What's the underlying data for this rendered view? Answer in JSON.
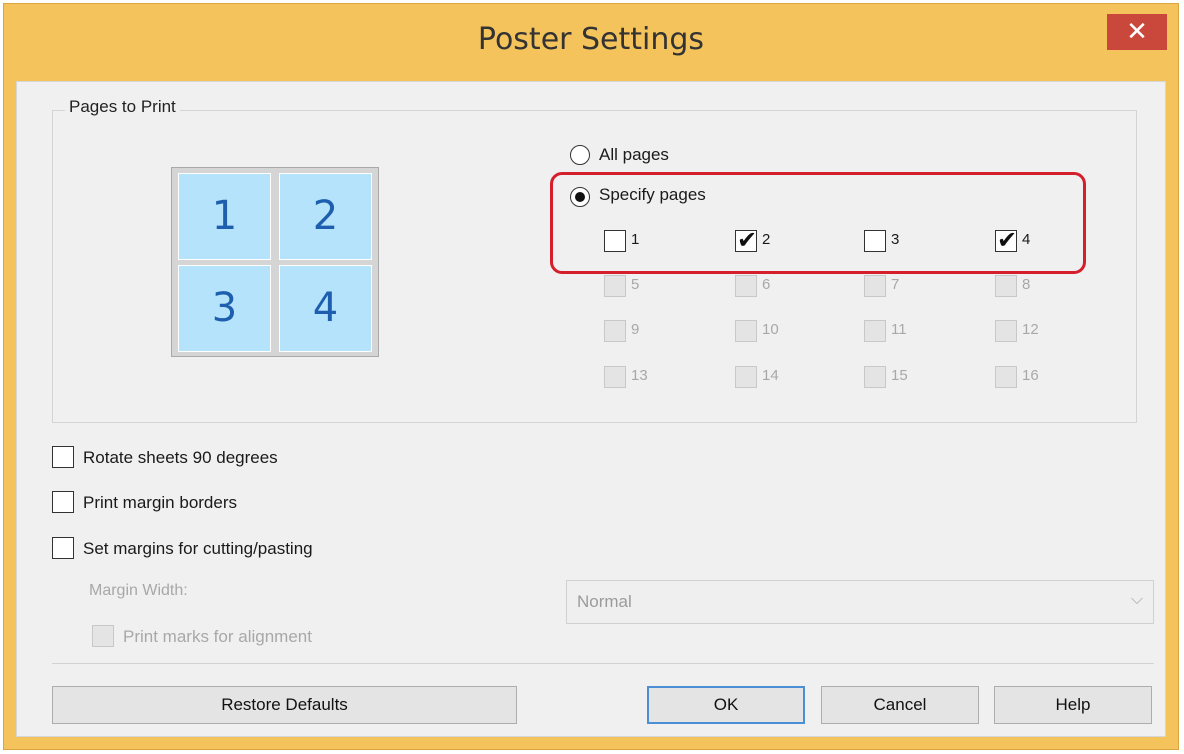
{
  "window": {
    "title": "Poster Settings",
    "close_glyph": "✕"
  },
  "pages_group": {
    "label": "Pages to Print",
    "preview_tiles": [
      "1",
      "2",
      "3",
      "4"
    ],
    "all_pages_label": "All pages",
    "specify_pages_label": "Specify pages",
    "selected_mode": "Specify pages",
    "pages": [
      {
        "label": "1",
        "checked": false,
        "enabled": true
      },
      {
        "label": "2",
        "checked": true,
        "enabled": true
      },
      {
        "label": "3",
        "checked": false,
        "enabled": true
      },
      {
        "label": "4",
        "checked": true,
        "enabled": true
      },
      {
        "label": "5",
        "checked": false,
        "enabled": false
      },
      {
        "label": "6",
        "checked": false,
        "enabled": false
      },
      {
        "label": "7",
        "checked": false,
        "enabled": false
      },
      {
        "label": "8",
        "checked": false,
        "enabled": false
      },
      {
        "label": "9",
        "checked": false,
        "enabled": false
      },
      {
        "label": "10",
        "checked": false,
        "enabled": false
      },
      {
        "label": "11",
        "checked": false,
        "enabled": false
      },
      {
        "label": "12",
        "checked": false,
        "enabled": false
      },
      {
        "label": "13",
        "checked": false,
        "enabled": false
      },
      {
        "label": "14",
        "checked": false,
        "enabled": false
      },
      {
        "label": "15",
        "checked": false,
        "enabled": false
      },
      {
        "label": "16",
        "checked": false,
        "enabled": false
      }
    ]
  },
  "options": {
    "rotate_label": "Rotate sheets 90 degrees",
    "rotate_checked": false,
    "margin_borders_label": "Print margin borders",
    "margin_borders_checked": false,
    "cutting_label": "Set margins for cutting/pasting",
    "cutting_checked": false,
    "margin_width_label": "Margin Width:",
    "margin_width_value": "Normal",
    "marks_label": "Print marks for alignment",
    "marks_checked": false
  },
  "buttons": {
    "restore": "Restore Defaults",
    "ok": "OK",
    "cancel": "Cancel",
    "help": "Help"
  },
  "colors": {
    "title_bar": "#f4c35c",
    "close_button": "#c9483b",
    "tile_fill": "#b5e3fb",
    "tile_text": "#1d5fae",
    "highlight": "#d41f2c"
  }
}
